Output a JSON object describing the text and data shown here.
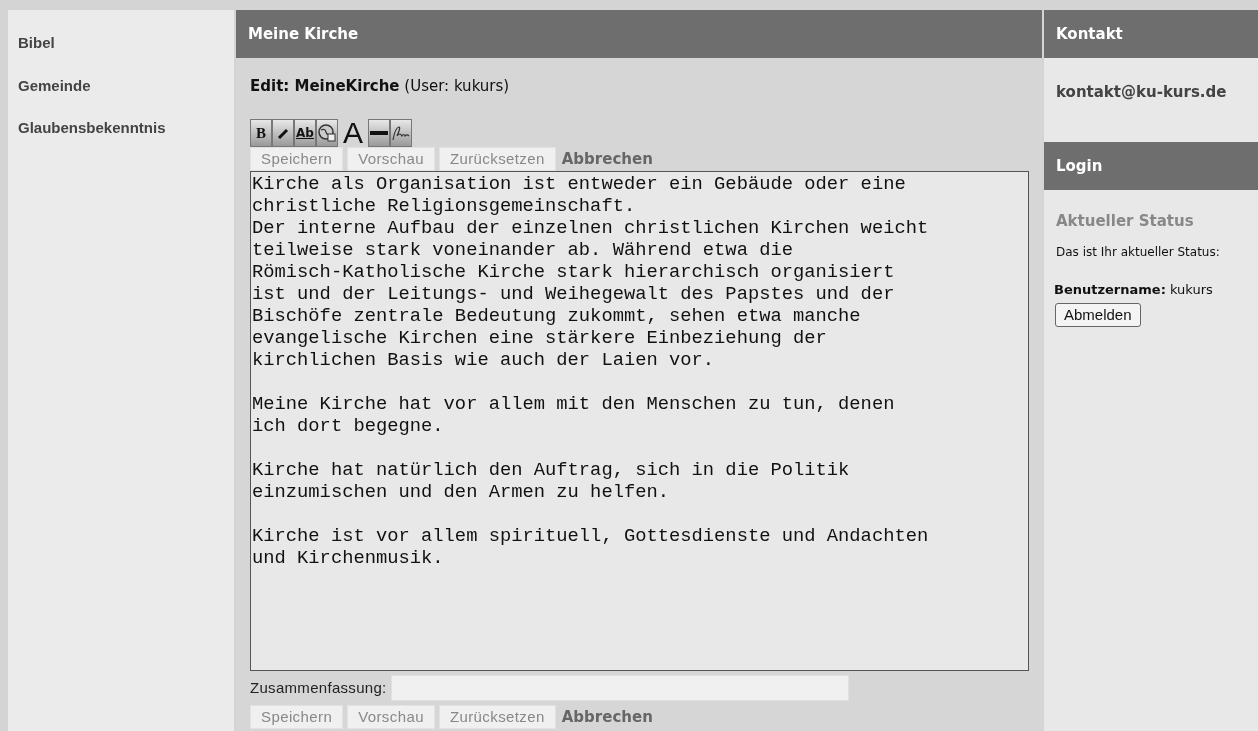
{
  "sidebar": {
    "items": [
      "Bibel",
      "Gemeinde",
      "Glaubensbekenntnis"
    ]
  },
  "main": {
    "title": "Meine Kirche",
    "edit_heading": "**Edit: MeineKirche** (User: kukurs)",
    "toolbar": [
      {
        "kind": "bold",
        "label": "B"
      },
      {
        "kind": "italic"
      },
      {
        "kind": "underline",
        "label": "Ab"
      },
      {
        "kind": "link"
      },
      {
        "kind": "font",
        "label": "A"
      },
      {
        "kind": "rule"
      },
      {
        "kind": "signature"
      }
    ],
    "buttons_top": [
      {
        "kind": "button",
        "label": "Speichern"
      },
      {
        "kind": "button",
        "label": "Vorschau"
      },
      {
        "kind": "button",
        "label": "Zurücksetzen"
      },
      {
        "kind": "link",
        "label": "Abbrechen"
      }
    ],
    "text": "Kirche als Organisation ist entweder ein Gebäude oder eine\nchristliche Religionsgemeinschaft.\nDer interne Aufbau der einzelnen christlichen Kirchen weicht\nteilweise stark voneinander ab. Während etwa die\nRömisch-Katholische Kirche stark hierarchisch organisiert\nist und der Leitungs- und Weihegewalt des Papstes und der\nBischöfe zentrale Bedeutung zukommt, sehen etwa manche\nevangelische Kirchen eine stärkere Einbeziehung der\nkirchlichen Basis wie auch der Laien vor.\n\nMeine Kirche hat vor allem mit den Menschen zu tun, denen\nich dort begegne.\n\nKirche hat natürlich den Auftrag, sich in die Politik\neinzumischen und den Armen zu helfen.\n\nKirche ist vor allem spirituell, Gottesdienste und Andachten\nund Kirchenmusik.",
    "summary_label": "Zusammenfassung:",
    "buttons_bottom": [
      {
        "kind": "button",
        "label": "Speichern"
      },
      {
        "kind": "button",
        "label": "Vorschau"
      },
      {
        "kind": "button",
        "label": "Zurücksetzen"
      },
      {
        "kind": "link",
        "label": "Abbrechen"
      }
    ]
  },
  "contact": {
    "title": "Kontakt",
    "email": "kontakt@ku-kurs.de"
  },
  "login": {
    "title": "Login",
    "status_heading": "Aktueller Status",
    "status_text": "Das ist Ihr aktueller Status:",
    "username": "**Benutzername:** kukurs",
    "logout_button": "Abmelden"
  }
}
